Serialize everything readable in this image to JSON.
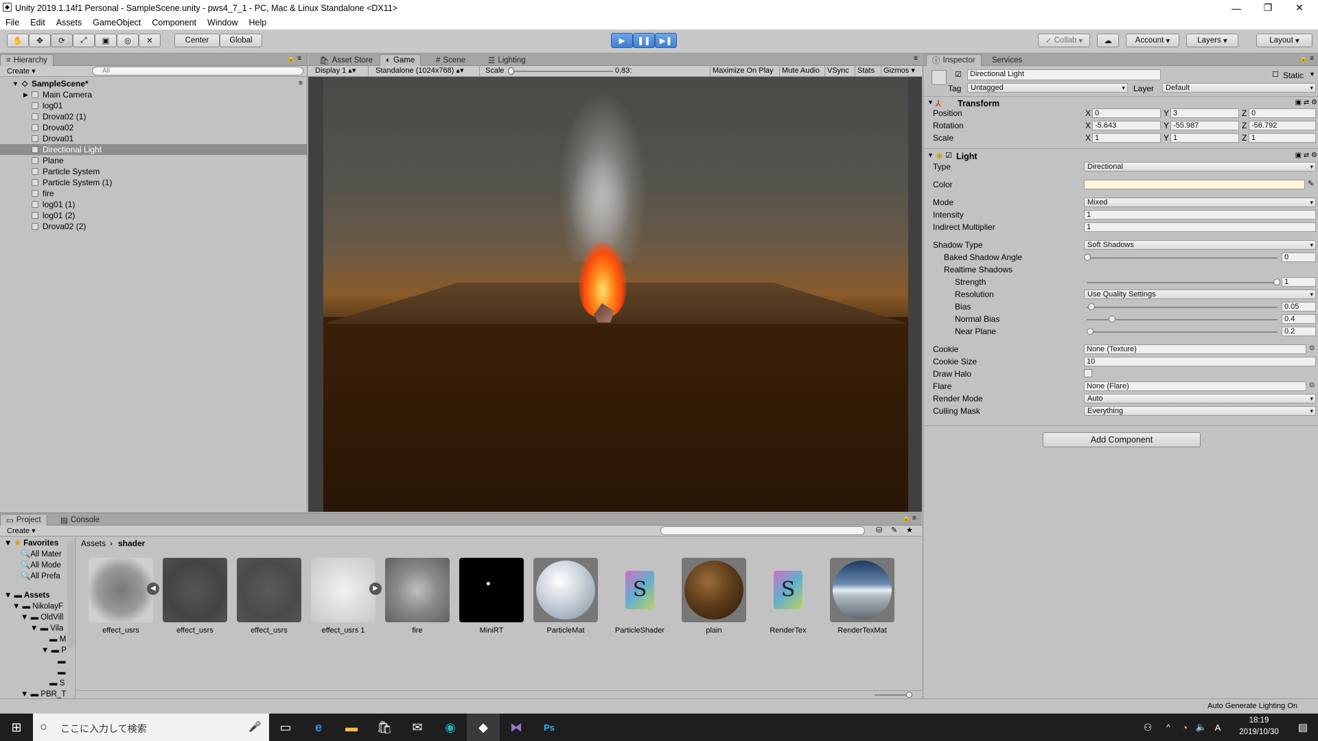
{
  "window": {
    "title": "Unity 2019.1.14f1 Personal - SampleScene.unity - pws4_7_1 - PC, Mac & Linux Standalone <DX11>"
  },
  "menu": [
    "File",
    "Edit",
    "Assets",
    "GameObject",
    "Component",
    "Window",
    "Help"
  ],
  "toolbar": {
    "center": "Center",
    "global": "Global",
    "collab": "Collab",
    "account": "Account",
    "layers": "Layers",
    "layout": "Layout"
  },
  "hierarchy": {
    "tab": "Hierarchy",
    "create": "Create",
    "search_placeholder": "All",
    "scene": "SampleScene*",
    "items": [
      "Main Camera",
      "log01",
      "Drova02 (1)",
      "Drova02",
      "Drova01",
      "Directional Light",
      "Plane",
      "Particle System",
      "Particle System (1)",
      "fire",
      "log01 (1)",
      "log01 (2)",
      "Drova02 (2)"
    ]
  },
  "center_tabs": [
    "Asset Store",
    "Game",
    "Scene",
    "Lighting"
  ],
  "game_bar": {
    "display": "Display 1",
    "resolution": "Standalone (1024x768)",
    "scale_label": "Scale",
    "scale_value": "0.83:",
    "maximize": "Maximize On Play",
    "mute": "Mute Audio",
    "vsync": "VSync",
    "stats": "Stats",
    "gizmos": "Gizmos"
  },
  "inspector": {
    "tabs": [
      "Inspector",
      "Services"
    ],
    "object_name": "Directional Light",
    "static_label": "Static",
    "tag_label": "Tag",
    "tag_value": "Untagged",
    "layer_label": "Layer",
    "layer_value": "Default",
    "transform": {
      "title": "Transform",
      "position": {
        "label": "Position",
        "x": "0",
        "y": "3",
        "z": "0"
      },
      "rotation": {
        "label": "Rotation",
        "x": "-5.643",
        "y": "-55.987",
        "z": "-56.792"
      },
      "scale": {
        "label": "Scale",
        "x": "1",
        "y": "1",
        "z": "1"
      }
    },
    "light": {
      "title": "Light",
      "type_label": "Type",
      "type_value": "Directional",
      "color_label": "Color",
      "color_value": "#fff6dc",
      "mode_label": "Mode",
      "mode_value": "Mixed",
      "intensity_label": "Intensity",
      "intensity_value": "1",
      "indirect_label": "Indirect Multiplier",
      "indirect_value": "1",
      "shadow_type_label": "Shadow Type",
      "shadow_type_value": "Soft Shadows",
      "baked_angle_label": "Baked Shadow Angle",
      "baked_angle_value": "0",
      "realtime_label": "Realtime Shadows",
      "strength_label": "Strength",
      "strength_value": "1",
      "resolution_label": "Resolution",
      "resolution_value": "Use Quality Settings",
      "bias_label": "Bias",
      "bias_value": "0.05",
      "normal_bias_label": "Normal Bias",
      "normal_bias_value": "0.4",
      "near_plane_label": "Near Plane",
      "near_plane_value": "0.2",
      "cookie_label": "Cookie",
      "cookie_value": "None (Texture)",
      "cookie_size_label": "Cookie Size",
      "cookie_size_value": "10",
      "draw_halo_label": "Draw Halo",
      "flare_label": "Flare",
      "flare_value": "None (Flare)",
      "render_mode_label": "Render Mode",
      "render_mode_value": "Auto",
      "culling_label": "Culling Mask",
      "culling_value": "Everything"
    },
    "add_component": "Add Component"
  },
  "project": {
    "tabs": [
      "Project",
      "Console"
    ],
    "create": "Create",
    "breadcrumb_root": "Assets",
    "breadcrumb_leaf": "shader",
    "favorites_label": "Favorites",
    "favorites": [
      "All Mater",
      "All Mode",
      "All Prefa"
    ],
    "assets_label": "Assets",
    "tree": [
      "NikolayF",
      "OldVill",
      "Vila",
      "M",
      "P",
      "S",
      "PBR_T"
    ],
    "assets": [
      "effect_usrs",
      "effect_usrs",
      "effect_usrs",
      "effect_usrs 1",
      "fire",
      "MiniRT",
      "ParticleMat",
      "ParticleShader",
      "plain",
      "RenderTex",
      "RenderTexMat"
    ]
  },
  "status": {
    "text": "Auto Generate Lighting On"
  },
  "taskbar": {
    "search_placeholder": "ここに入力して検索",
    "time": "18:19",
    "date": "2019/10/30",
    "ime": "A"
  }
}
